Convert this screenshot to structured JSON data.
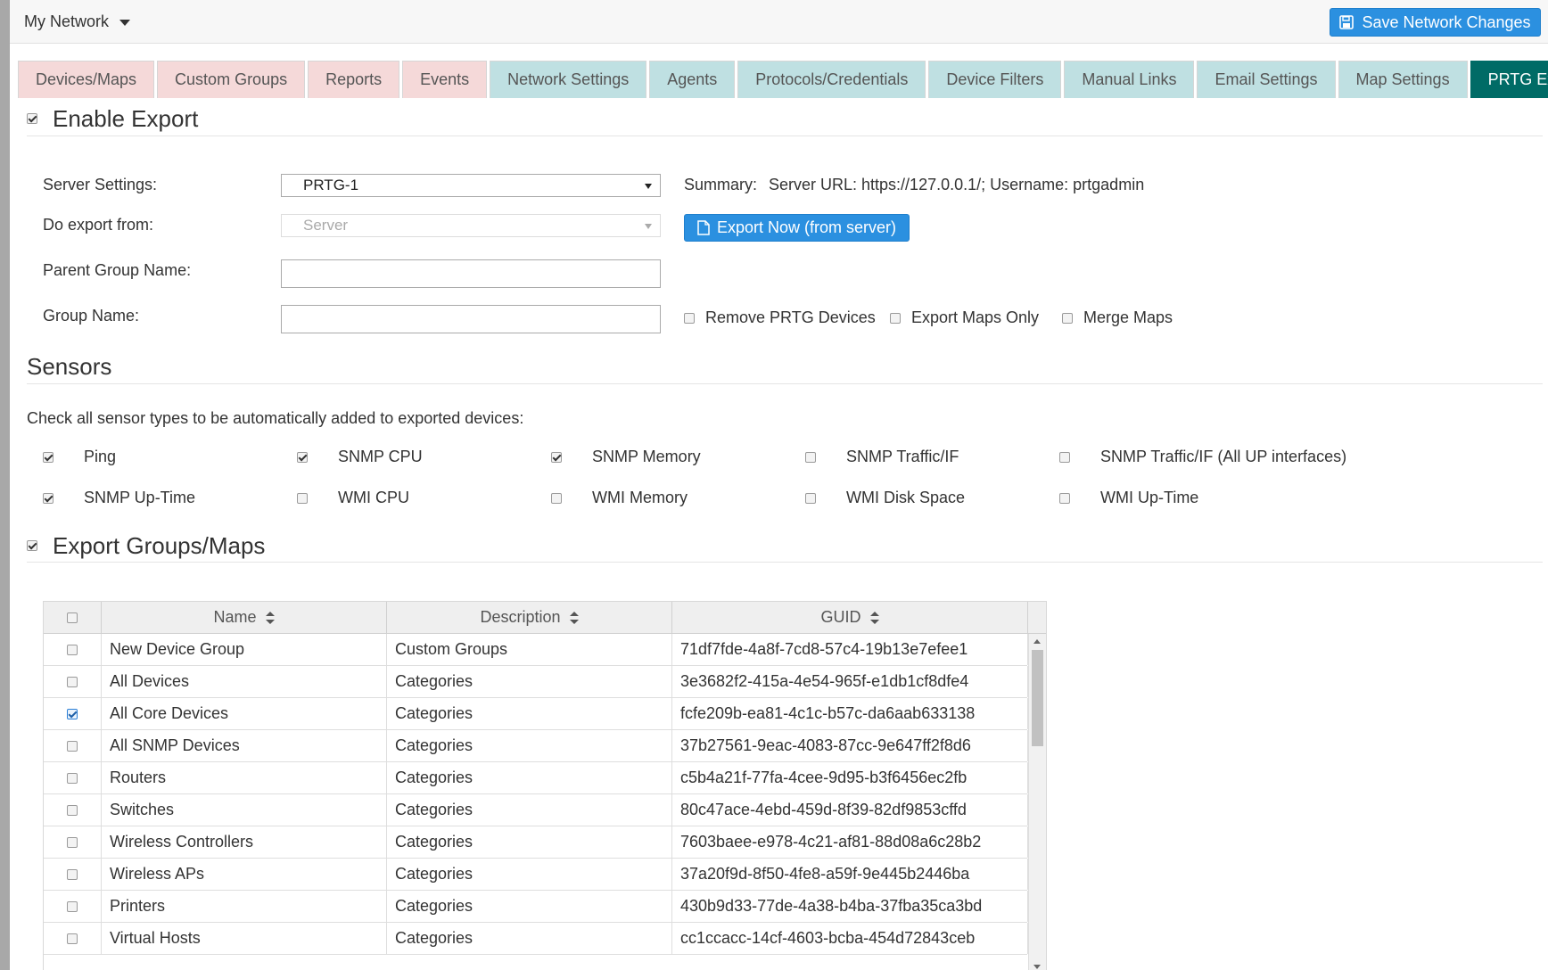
{
  "topbar": {
    "network_menu": "My Network",
    "save_button": "Save Network Changes"
  },
  "tabs": [
    {
      "label": "Devices/Maps",
      "style": "pink"
    },
    {
      "label": "Custom Groups",
      "style": "pink"
    },
    {
      "label": "Reports",
      "style": "pink"
    },
    {
      "label": "Events",
      "style": "pink"
    },
    {
      "label": "Network Settings",
      "style": "teal"
    },
    {
      "label": "Agents",
      "style": "teal"
    },
    {
      "label": "Protocols/Credentials",
      "style": "teal"
    },
    {
      "label": "Device Filters",
      "style": "teal"
    },
    {
      "label": "Manual Links",
      "style": "teal"
    },
    {
      "label": "Email Settings",
      "style": "teal"
    },
    {
      "label": "Map Settings",
      "style": "teal"
    },
    {
      "label": "PRTG Export",
      "style": "active"
    }
  ],
  "enable_export": {
    "title": "Enable Export",
    "checked": true
  },
  "form": {
    "server_settings_label": "Server Settings:",
    "server_settings_value": "PRTG-1",
    "do_export_from_label": "Do export from:",
    "do_export_from_value": "Server",
    "parent_group_label": "Parent Group Name:",
    "parent_group_value": "",
    "group_name_label": "Group Name:",
    "group_name_value": "",
    "summary_label": "Summary:",
    "summary_value": "Server URL: https://127.0.0.1/; Username: prtgadmin",
    "export_now_button": "Export Now (from server)",
    "options": [
      {
        "label": "Remove PRTG Devices",
        "checked": false
      },
      {
        "label": "Export Maps Only",
        "checked": false
      },
      {
        "label": "Merge Maps",
        "checked": false
      }
    ]
  },
  "sensors": {
    "title": "Sensors",
    "instruction": "Check all sensor types to be automatically added to exported devices:",
    "items": [
      {
        "label": "Ping",
        "checked": true
      },
      {
        "label": "SNMP CPU",
        "checked": true
      },
      {
        "label": "SNMP Memory",
        "checked": true
      },
      {
        "label": "SNMP Traffic/IF",
        "checked": false
      },
      {
        "label": "SNMP Traffic/IF (All UP interfaces)",
        "checked": false
      },
      {
        "label": "SNMP Up-Time",
        "checked": true
      },
      {
        "label": "WMI CPU",
        "checked": false
      },
      {
        "label": "WMI Memory",
        "checked": false
      },
      {
        "label": "WMI Disk Space",
        "checked": false
      },
      {
        "label": "WMI Up-Time",
        "checked": false
      }
    ]
  },
  "export_groups": {
    "title": "Export Groups/Maps",
    "checked": true
  },
  "table": {
    "columns": [
      "Name",
      "Description",
      "GUID"
    ],
    "rows": [
      {
        "name": "New Device Group",
        "description": "Custom Groups",
        "guid": "71df7fde-4a8f-7cd8-57c4-19b13e7efee1",
        "checked": false
      },
      {
        "name": "All Devices",
        "description": "Categories",
        "guid": "3e3682f2-415a-4e54-965f-e1db1cf8dfe4",
        "checked": false
      },
      {
        "name": "All Core Devices",
        "description": "Categories",
        "guid": "fcfe209b-ea81-4c1c-b57c-da6aab633138",
        "checked": true
      },
      {
        "name": "All SNMP Devices",
        "description": "Categories",
        "guid": "37b27561-9eac-4083-87cc-9e647ff2f8d6",
        "checked": false
      },
      {
        "name": "Routers",
        "description": "Categories",
        "guid": "c5b4a21f-77fa-4cee-9d95-b3f6456ec2fb",
        "checked": false
      },
      {
        "name": "Switches",
        "description": "Categories",
        "guid": "80c47ace-4ebd-459d-8f39-82df9853cffd",
        "checked": false
      },
      {
        "name": "Wireless Controllers",
        "description": "Categories",
        "guid": "7603baee-e978-4c21-af81-88d08a6c28b2",
        "checked": false
      },
      {
        "name": "Wireless APs",
        "description": "Categories",
        "guid": "37a20f9d-8f50-4fe8-a59f-9e445b2446ba",
        "checked": false
      },
      {
        "name": "Printers",
        "description": "Categories",
        "guid": "430b9d33-77de-4a38-b4ba-37fba35ca3bd",
        "checked": false
      },
      {
        "name": "Virtual Hosts",
        "description": "Categories",
        "guid": "cc1ccacc-14cf-4603-bcba-454d72843ceb",
        "checked": false
      }
    ]
  }
}
